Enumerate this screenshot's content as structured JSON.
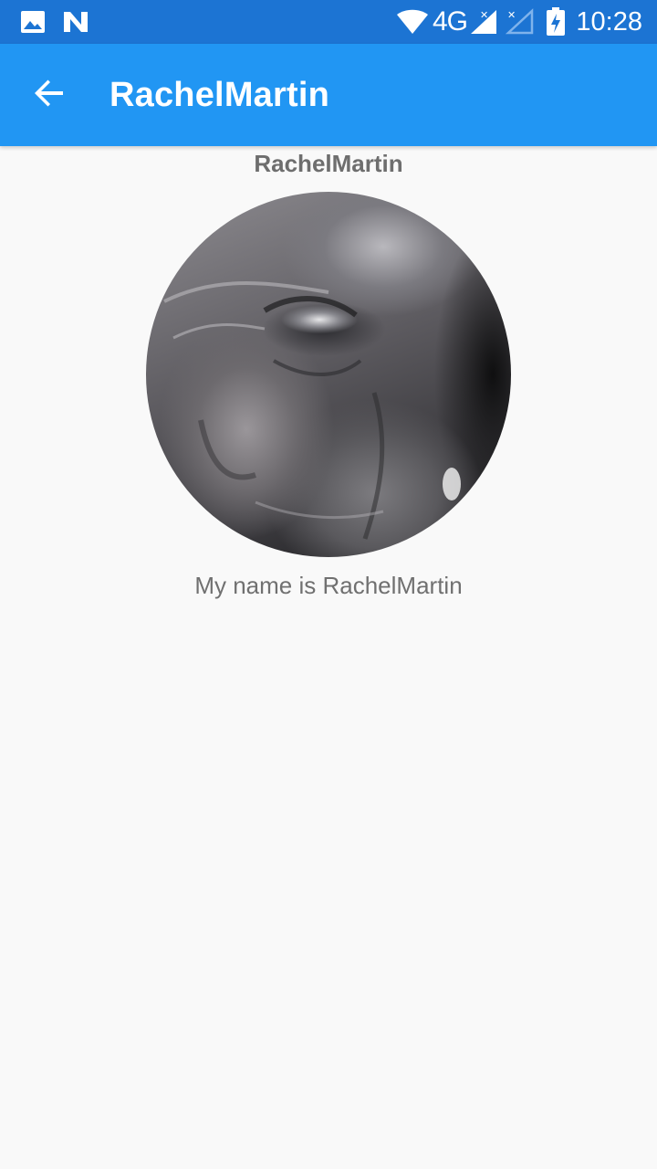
{
  "status_bar": {
    "network_type": "4G",
    "time": "10:28",
    "icons": [
      "gallery-icon",
      "n-notification-icon",
      "wifi-icon",
      "signal-icon",
      "signal-no-sim-icon",
      "battery-charging-icon"
    ]
  },
  "app_bar": {
    "back_icon": "arrow-back-icon",
    "title": "RachelMartin"
  },
  "profile": {
    "heading": "RachelMartin",
    "description": "My name is RachelMartin"
  },
  "colors": {
    "status_bar": "#1c74d3",
    "app_bar": "#2196f3",
    "background": "#f9f9f9",
    "text_secondary": "#707070"
  }
}
